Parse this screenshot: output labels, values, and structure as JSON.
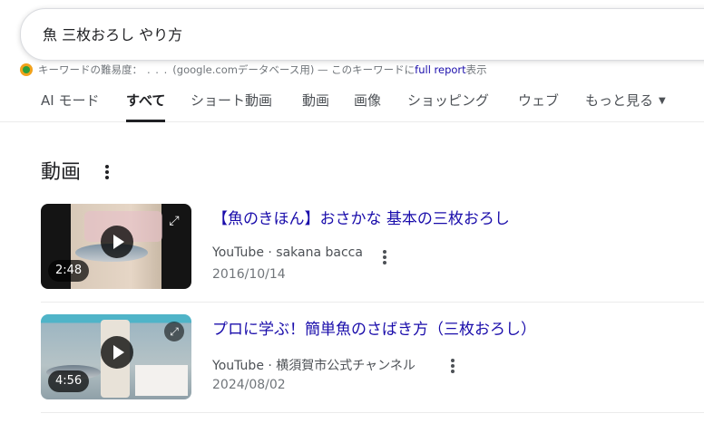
{
  "search": {
    "query": "魚 三枚おろし やり方"
  },
  "keyword_bar": {
    "prefix": "キーワードの難易度：",
    "dots": ". . .",
    "middle": "(google.comデータベース用) — このキーワードに",
    "link": "full report",
    "suffix": "表示"
  },
  "tabs": [
    {
      "label": "AI モード",
      "active": false
    },
    {
      "label": "すべて",
      "active": true
    },
    {
      "label": "ショート動画",
      "active": false
    },
    {
      "label": "動画",
      "active": false
    },
    {
      "label": "画像",
      "active": false
    },
    {
      "label": "ショッピング",
      "active": false
    },
    {
      "label": "ウェブ",
      "active": false
    },
    {
      "label": "もっと見る",
      "active": false
    }
  ],
  "section": {
    "title": "動画"
  },
  "videos": [
    {
      "title": "【魚のきほん】おさかな 基本の三枚おろし",
      "source": "YouTube · sakana bacca",
      "date": "2016/10/14",
      "duration": "2:48"
    },
    {
      "title": "プロに学ぶ！簡単魚のさばき方（三枚おろし）",
      "source": "YouTube · 横須賀市公式チャンネル",
      "date": "2024/08/02",
      "duration": "4:56"
    }
  ],
  "icons": {
    "seo_badge": "seo-badge-icon",
    "more": "more-vert-icon",
    "play": "play-icon",
    "expand": "expand-icon"
  }
}
